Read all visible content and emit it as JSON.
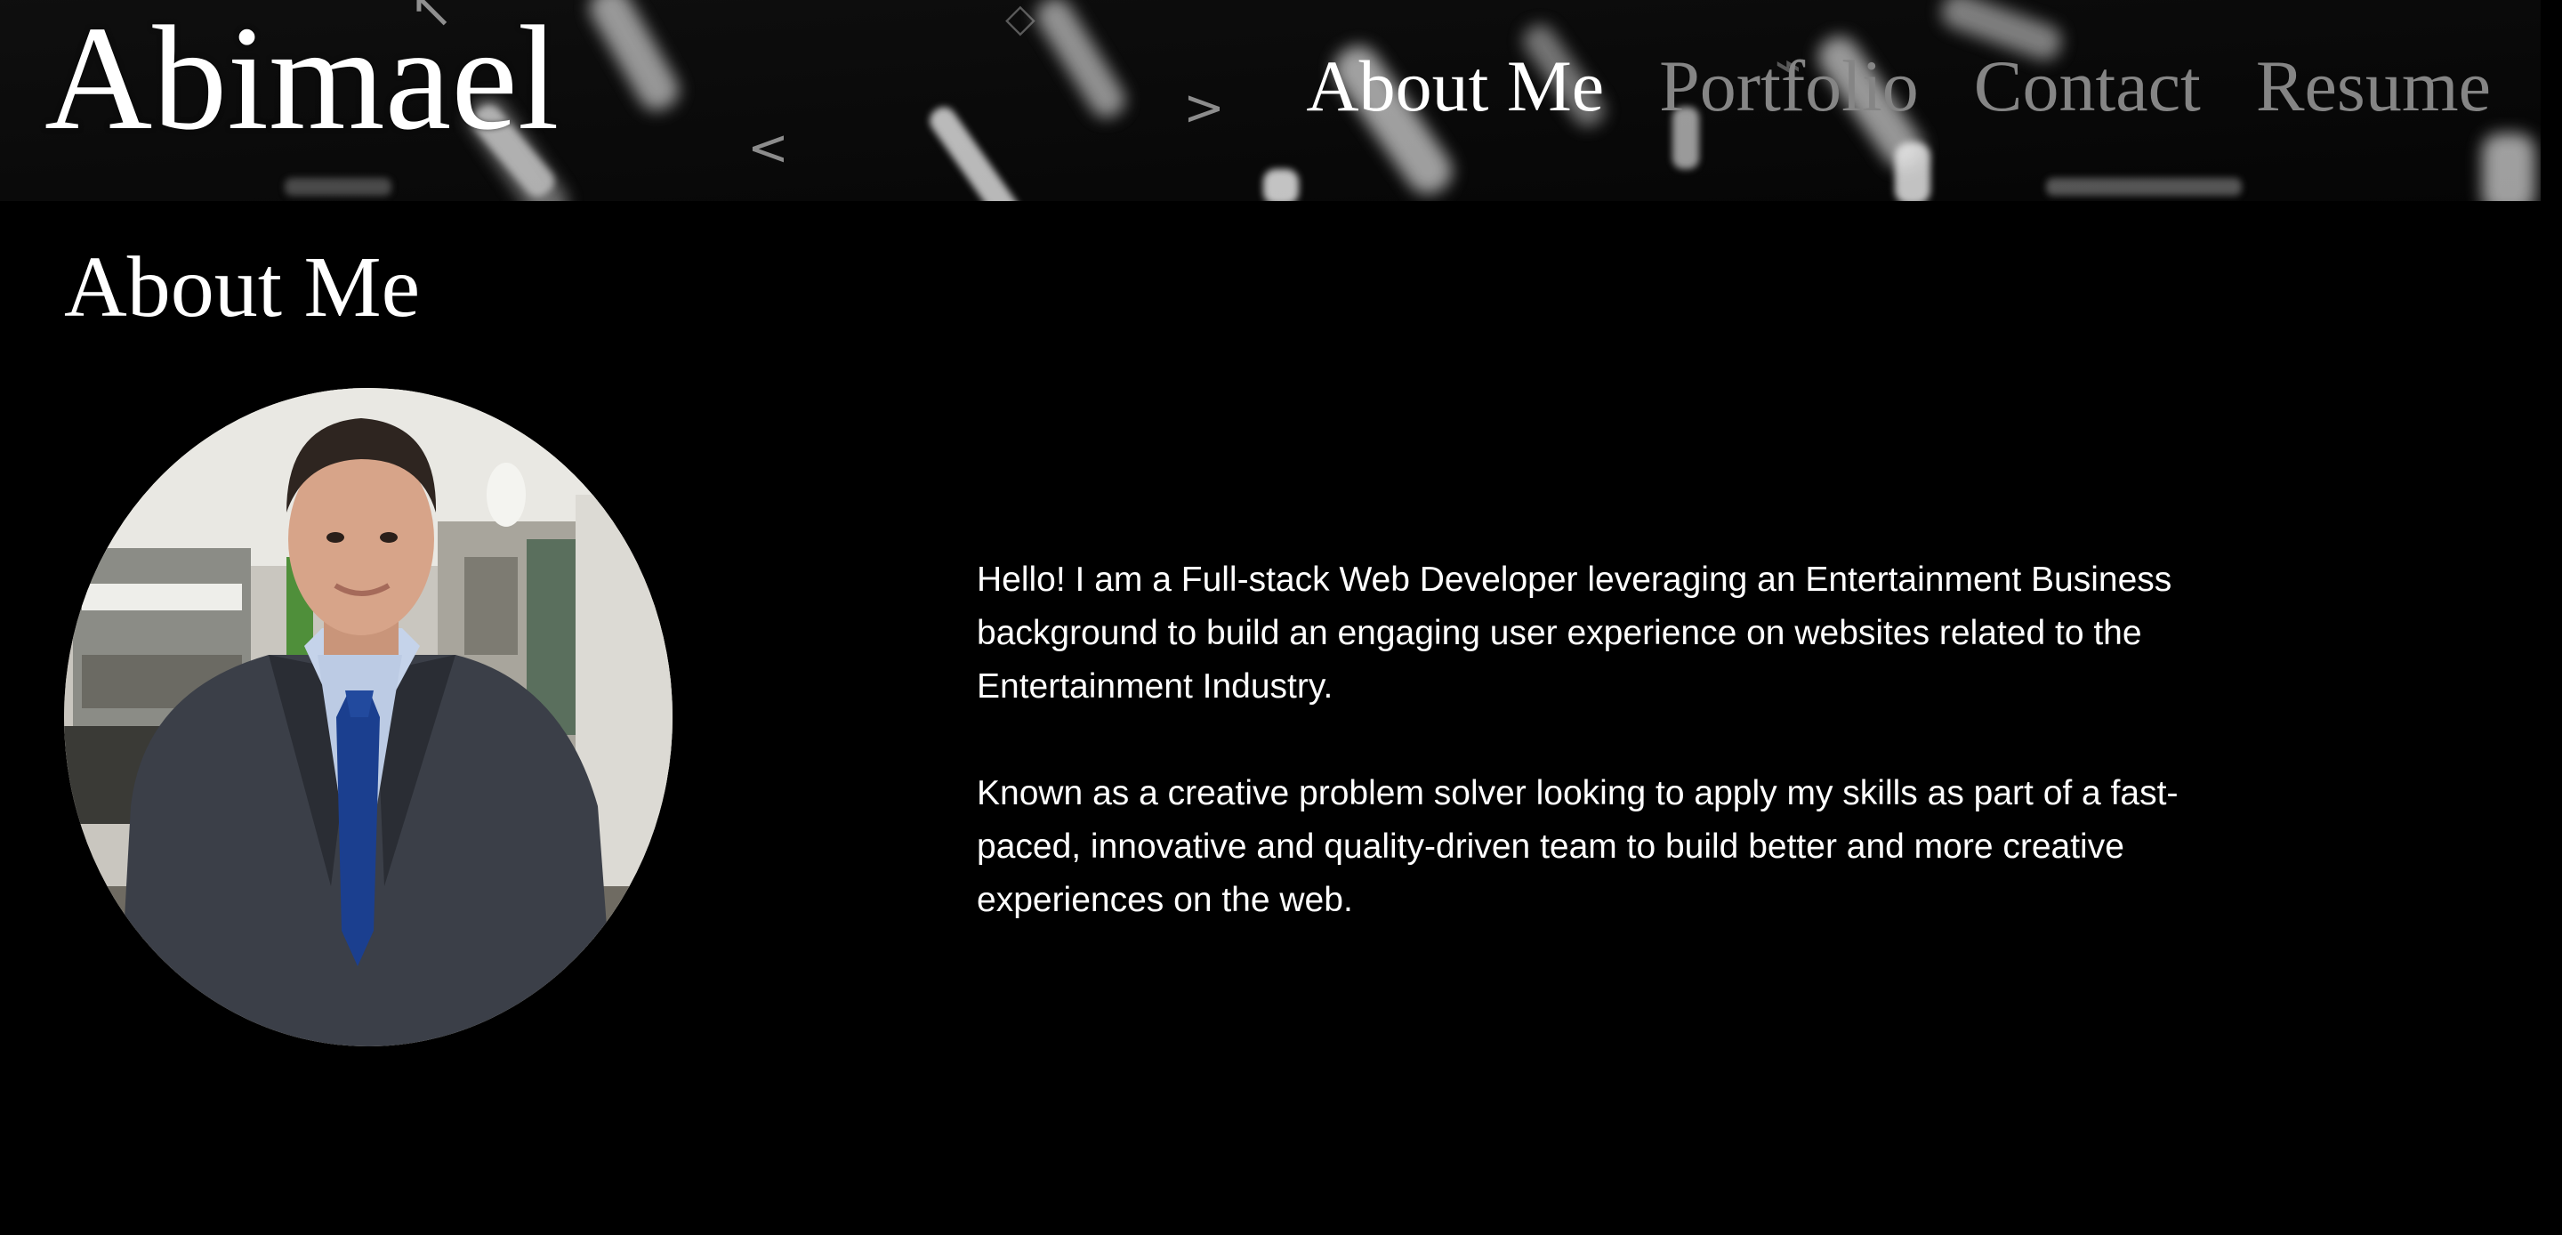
{
  "site": {
    "brand": "Abimael"
  },
  "nav": {
    "items": [
      {
        "label": "About Me",
        "active": true
      },
      {
        "label": "Portfolio",
        "active": false
      },
      {
        "label": "Contact",
        "active": false
      },
      {
        "label": "Resume",
        "active": false
      }
    ]
  },
  "about": {
    "title": "About Me",
    "paragraphs": [
      "Hello! I am a Full-stack Web Developer leveraging an Entertainment Business background to build an engaging user experience on websites related to the Entertainment Industry.",
      "Known as a creative problem solver looking to apply my skills as part of a fast-paced, innovative and quality-driven team to build better and more creative experiences on the web."
    ]
  },
  "colors": {
    "background": "#000000",
    "text": "#ffffff",
    "nav_inactive": "#858585",
    "nav_active": "#ffffff"
  }
}
